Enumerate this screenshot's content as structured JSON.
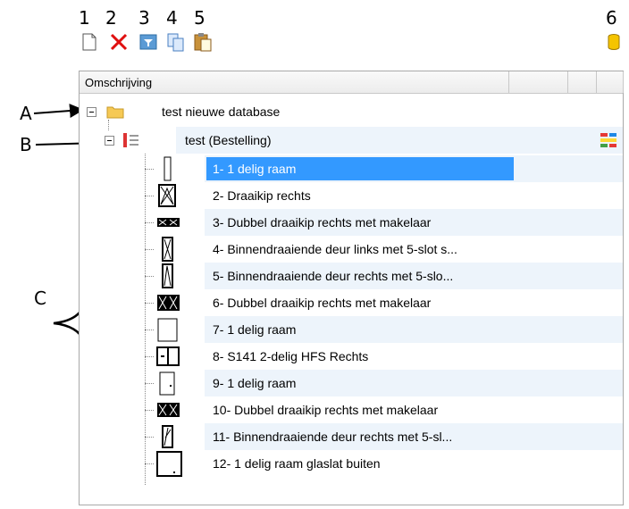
{
  "callouts": {
    "numbers": [
      "1",
      "2",
      "3",
      "4",
      "5",
      "6"
    ],
    "letters": {
      "a": "A",
      "b": "B",
      "c": "C"
    }
  },
  "toolbar": {
    "icons": [
      "new-document-icon",
      "delete-icon",
      "filter-icon",
      "copy-icon",
      "paste-icon",
      "database-icon"
    ]
  },
  "tree": {
    "column_header": "Omschrijving",
    "root": {
      "label": "test nieuwe database",
      "expander": "−"
    },
    "child": {
      "label": "test (Bestelling)",
      "expander": "−"
    },
    "items": [
      "1- 1 delig raam",
      "2- Draaikip rechts",
      "3- Dubbel draaikip rechts met makelaar",
      "4- Binnendraaiende deur links met 5-slot s...",
      "5- Binnendraaiende deur rechts met 5-slo...",
      "6- Dubbel draaikip rechts met makelaar",
      "7- 1 delig raam",
      "8- S141 2-delig HFS Rechts",
      "9- 1 delig raam",
      "10- Dubbel draaikip rechts met makelaar",
      "11- Binnendraaiende deur rechts met 5-sl...",
      "12- 1 delig raam glaslat buiten"
    ],
    "selected_index": 0
  },
  "colors": {
    "selection": "#3399ff",
    "band": "#edf4fb"
  }
}
